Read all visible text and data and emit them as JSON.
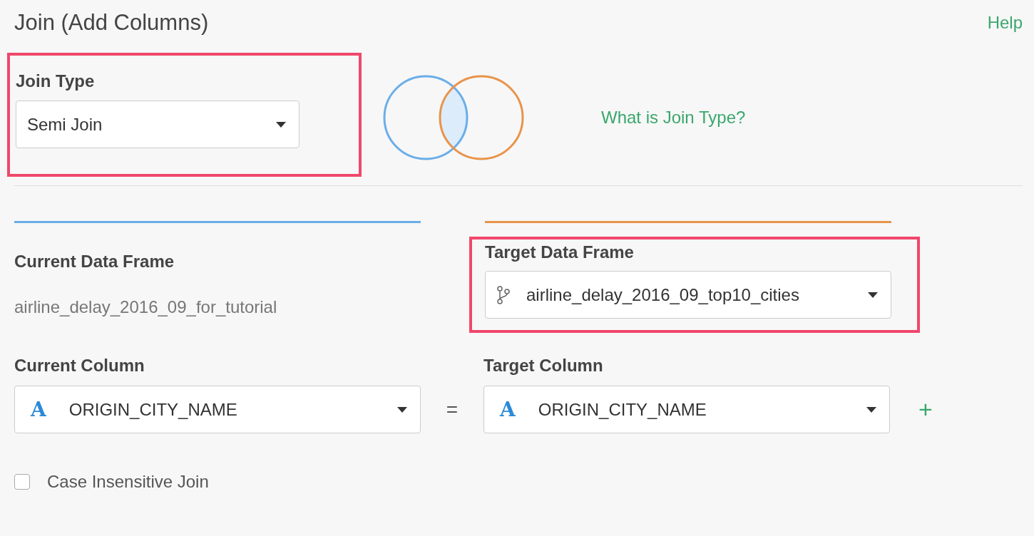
{
  "title": "Join (Add Columns)",
  "help_link": "Help",
  "join_type": {
    "label": "Join Type",
    "value": "Semi Join",
    "highlighted": true
  },
  "join_type_help": "What is Join Type?",
  "current_frame": {
    "label": "Current Data Frame",
    "value": "airline_delay_2016_09_for_tutorial"
  },
  "target_frame": {
    "label": "Target Data Frame",
    "value": "airline_delay_2016_09_top10_cities",
    "highlighted": true
  },
  "current_column": {
    "label": "Current Column",
    "type_icon": "A",
    "value": "ORIGIN_CITY_NAME"
  },
  "equals": "=",
  "target_column": {
    "label": "Target Column",
    "type_icon": "A",
    "value": "ORIGIN_CITY_NAME"
  },
  "add_button": "+",
  "case_insensitive": {
    "label": "Case Insensitive Join",
    "checked": false
  }
}
